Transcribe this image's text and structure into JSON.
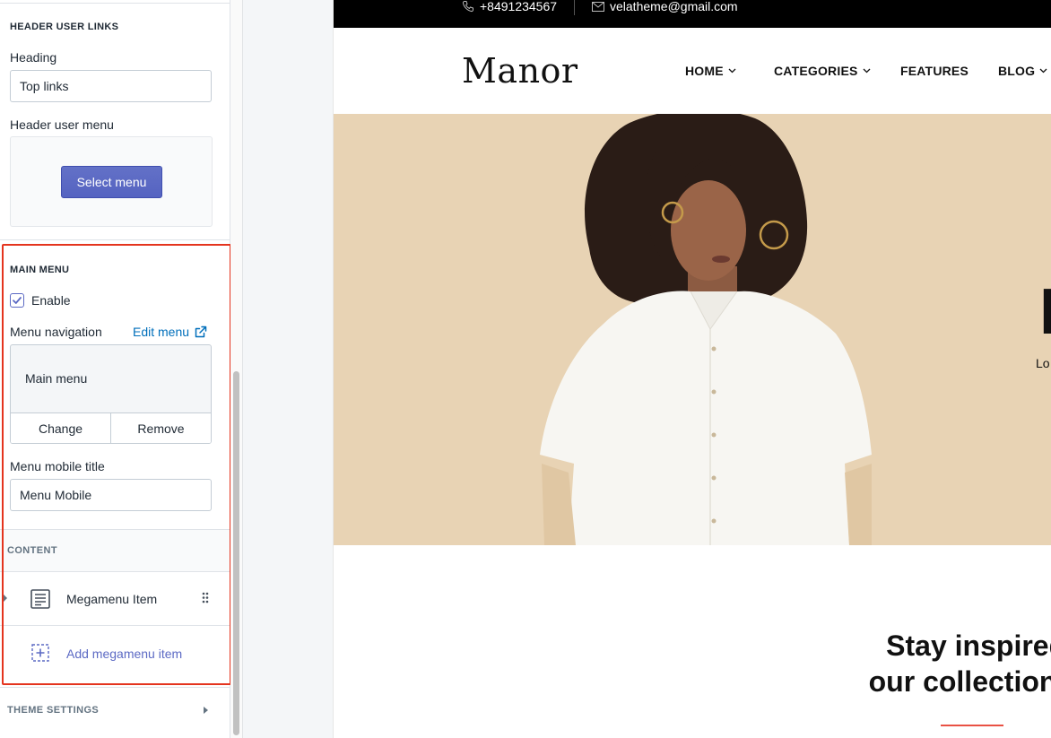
{
  "sidebar": {
    "header_user_links": {
      "title": "HEADER USER LINKS",
      "heading_label": "Heading",
      "heading_value": "Top links",
      "user_menu_label": "Header user menu",
      "select_menu_button": "Select menu"
    },
    "main_menu": {
      "title": "MAIN MENU",
      "enable_label": "Enable",
      "enable_checked": true,
      "nav_label": "Menu navigation",
      "edit_menu_link": "Edit menu",
      "selected_menu": "Main menu",
      "change_button": "Change",
      "remove_button": "Remove",
      "mobile_title_label": "Menu mobile title",
      "mobile_title_value": "Menu Mobile"
    },
    "content": {
      "title": "CONTENT",
      "items": [
        {
          "label": "Megamenu Item"
        }
      ],
      "add_item": "Add megamenu item"
    },
    "theme_settings": "THEME SETTINGS"
  },
  "preview": {
    "topbar": {
      "phone": "+8491234567",
      "email": "velatheme@gmail.com"
    },
    "logo": "Manor",
    "nav": [
      {
        "label": "HOME",
        "has_dropdown": true
      },
      {
        "label": "CATEGORIES",
        "has_dropdown": true
      },
      {
        "label": "FEATURES",
        "has_dropdown": false
      },
      {
        "label": "BLOG",
        "has_dropdown": true
      }
    ],
    "hero": {
      "title_fragment": "N",
      "subtitle_fragment": "Lo"
    },
    "section": {
      "line1": "Stay inspired with",
      "line2": "our collections this"
    }
  },
  "colors": {
    "primary_button": "#5c6ac4",
    "link": "#006fbb",
    "highlight": "#e4341e",
    "hero_bg": "#e8d3b4",
    "accent_line": "#e95144"
  }
}
